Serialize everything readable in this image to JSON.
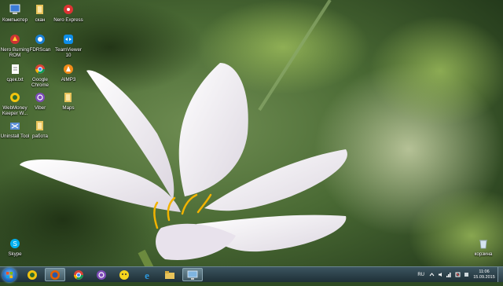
{
  "desktop": {
    "icons": [
      {
        "label": "Компьютер",
        "icon": "computer-icon"
      },
      {
        "label": "скан",
        "icon": "folder-icon"
      },
      {
        "label": "Nero Express",
        "icon": "nero-express-icon"
      },
      {
        "label": "Nero Burning ROM",
        "icon": "nero-burning-rom-icon"
      },
      {
        "label": "FDRScan",
        "icon": "fdrscan-icon"
      },
      {
        "label": "TeamViewer 10",
        "icon": "teamviewer-icon"
      },
      {
        "label": "сдек.txt",
        "icon": "text-file-icon"
      },
      {
        "label": "Google Chrome",
        "icon": "chrome-icon"
      },
      {
        "label": "AIMP3",
        "icon": "aimp-icon"
      },
      {
        "label": "WebMoney Keeper W...",
        "icon": "webmoney-icon"
      },
      {
        "label": "Viber",
        "icon": "viber-icon"
      },
      {
        "label": "Maps",
        "icon": "folder-icon"
      },
      {
        "label": "Uninstall Tool",
        "icon": "uninstall-tool-icon"
      },
      {
        "label": "работа",
        "icon": "folder-icon"
      },
      {
        "label": "Skype",
        "icon": "skype-icon"
      },
      {
        "label": "корзина",
        "icon": "recycle-bin-icon"
      }
    ]
  },
  "taskbar": {
    "items": [
      {
        "name": "webmoney",
        "icon": "webmoney-icon"
      },
      {
        "name": "firefox",
        "icon": "firefox-icon",
        "active": true
      },
      {
        "name": "chrome",
        "icon": "chrome-icon"
      },
      {
        "name": "viber",
        "icon": "viber-icon"
      },
      {
        "name": "kakaotalk",
        "icon": "chat-icon"
      },
      {
        "name": "internet-explorer",
        "icon": "internet-explorer-icon"
      },
      {
        "name": "explorer",
        "icon": "file-explorer-icon"
      },
      {
        "name": "remote-desktop",
        "icon": "remote-desktop-icon",
        "active": true
      }
    ],
    "tray": {
      "language": "RU",
      "time": "11:06",
      "date": "15.09.2015"
    }
  },
  "colors": {
    "taskbar_top": "#3c5560",
    "taskbar_bottom": "#1e2f36",
    "accent": "#1a5fb0"
  }
}
